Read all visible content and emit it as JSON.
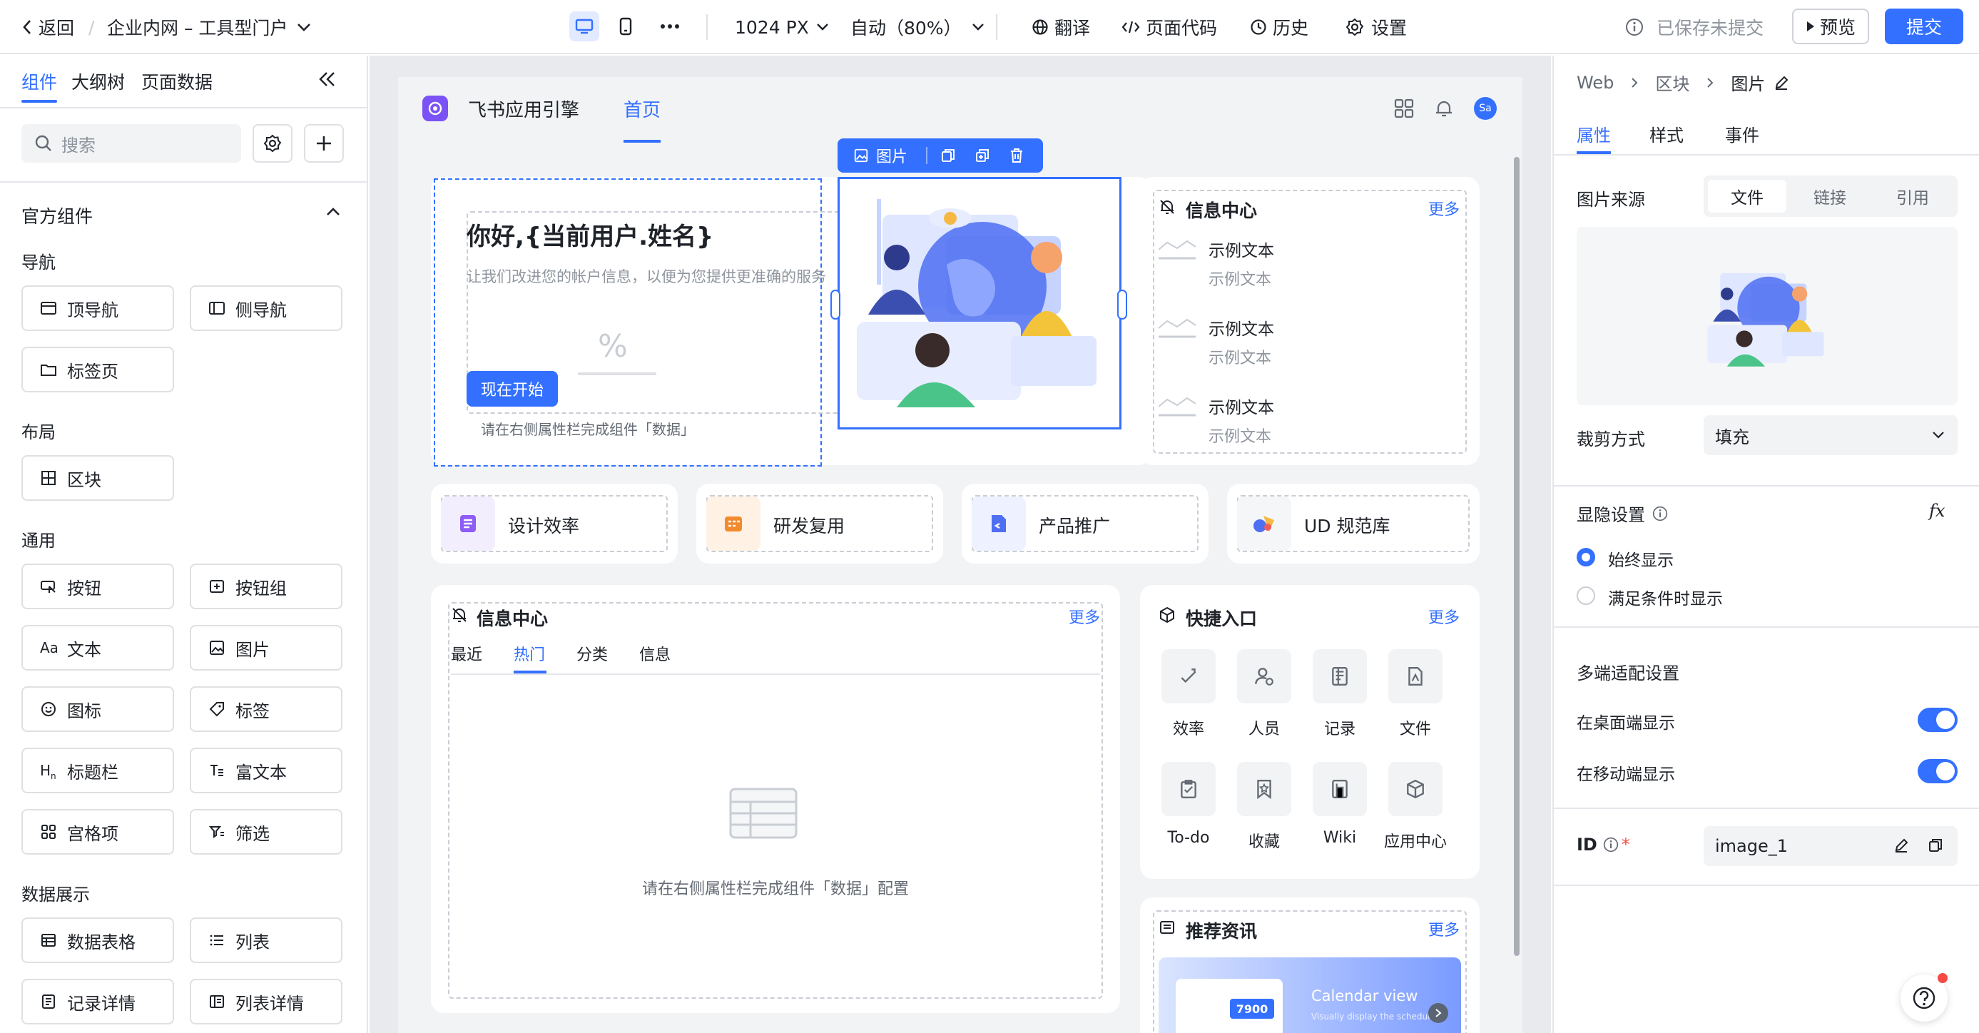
{
  "topbar": {
    "back": "返回",
    "app_title": "企业内网 – 工具型门户",
    "width_value": "1024 PX",
    "zoom_value": "自动（80%）",
    "translate": "翻译",
    "page_code": "页面代码",
    "history": "历史",
    "settings": "设置",
    "save_status": "已保存未提交",
    "preview": "预览",
    "submit": "提交"
  },
  "left_panel": {
    "tabs": [
      "组件",
      "大纲树",
      "页面数据"
    ],
    "search_placeholder": "搜索",
    "section_title": "官方组件",
    "groups": {
      "nav": "导航",
      "layout": "布局",
      "general": "通用",
      "data": "数据展示"
    },
    "components": {
      "top_nav": "顶导航",
      "side_nav": "侧导航",
      "tab_page": "标签页",
      "block": "区块",
      "button": "按钮",
      "button_group": "按钮组",
      "text": "文本",
      "image": "图片",
      "icon": "图标",
      "tag": "标签",
      "title_bar": "标题栏",
      "rich_text": "富文本",
      "grid_item": "宫格项",
      "filter": "筛选",
      "data_table": "数据表格",
      "list": "列表",
      "record_detail": "记录详情",
      "list_detail": "列表详情"
    }
  },
  "canvas": {
    "brand": "飞书应用引擎",
    "nav_home": "首页",
    "user_initials": "Sa",
    "toolbar_label": "图片",
    "hero": {
      "title": "你好,{当前用户.姓名}",
      "subtitle": "让我们改进您的帐户信息，以便为您提供更准确的服务",
      "start_button": "现在开始",
      "hint": "请在右侧属性栏完成组件「数据」"
    },
    "info_center_top": {
      "title": "信息中心",
      "more": "更多",
      "items": [
        {
          "title": "示例文本",
          "sub": "示例文本"
        },
        {
          "title": "示例文本",
          "sub": "示例文本"
        },
        {
          "title": "示例文本",
          "sub": "示例文本"
        }
      ]
    },
    "shortcuts": [
      "设计效率",
      "研发复用",
      "产品推广",
      "UD 规范库"
    ],
    "info_center_bottom": {
      "title": "信息中心",
      "more": "更多",
      "tabs": [
        "最近",
        "热门",
        "分类",
        "信息"
      ],
      "empty_hint": "请在右侧属性栏完成组件「数据」配置"
    },
    "quick_entry": {
      "title": "快捷入口",
      "more": "更多",
      "items": [
        "效率",
        "人员",
        "记录",
        "文件",
        "To-do",
        "收藏",
        "Wiki",
        "应用中心"
      ]
    },
    "news": {
      "title": "推荐资讯",
      "more": "更多",
      "banner_title": "Calendar view",
      "banner_sub": "Visually display the schedule",
      "banner_number": "7900"
    }
  },
  "right_panel": {
    "breadcrumb": [
      "Web",
      "区块",
      "图片"
    ],
    "tabs": [
      "属性",
      "样式",
      "事件"
    ],
    "image_source_label": "图片来源",
    "source_options": [
      "文件",
      "链接",
      "引用"
    ],
    "crop_label": "裁剪方式",
    "crop_value": "填充",
    "visibility_label": "显隐设置",
    "fx": "fx",
    "visibility_options": [
      "始终显示",
      "满足条件时显示"
    ],
    "multi_label": "多端适配设置",
    "desktop_label": "在桌面端显示",
    "mobile_label": "在移动端显示",
    "id_label": "ID",
    "id_required": "*",
    "id_value": "image_1"
  },
  "colors": {
    "accent": "#3370ff",
    "border": "#dee0e3",
    "canvas_bg": "#e9eaed"
  }
}
